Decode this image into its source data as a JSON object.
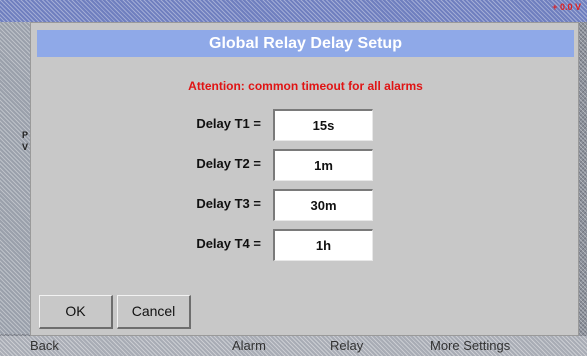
{
  "background": {
    "top_right_value": "+ 0.0 V",
    "left_labels": [
      "P",
      "V"
    ],
    "bottom_items": [
      "Back",
      "Alarm",
      "Relay",
      "More Settings"
    ]
  },
  "dialog": {
    "title": "Global Relay Delay Setup",
    "attention": "Attention: common timeout for all alarms",
    "delays": [
      {
        "label": "Delay T1 =",
        "value": "15s"
      },
      {
        "label": "Delay T2 =",
        "value": "1m"
      },
      {
        "label": "Delay T3 =",
        "value": "30m"
      },
      {
        "label": "Delay T4 =",
        "value": "1h"
      }
    ],
    "ok_label": "OK",
    "cancel_label": "Cancel"
  },
  "colors": {
    "title_bar": "#8fa9e8",
    "attention_text": "#e01414",
    "dialog_bg": "#c8c8c8"
  }
}
